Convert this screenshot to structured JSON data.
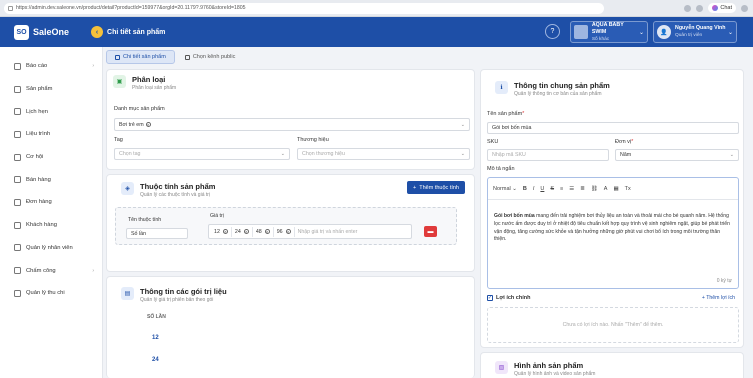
{
  "browser": {
    "url": "https://admin.dev.saleone.vn/product/detail?productId=159977&orgId=20.1179?.9760&storeId=1805",
    "chat_label": "Chat"
  },
  "topnav": {
    "logo": "SO",
    "brand": "SaleOne",
    "title": "Chi tiết sản phẩm",
    "help": "?",
    "store": {
      "name": "AQUA BABY SWIM",
      "sub": "Số khác"
    },
    "user": {
      "name": "Nguyễn Quang Vinh",
      "role": "Quản trị viên"
    }
  },
  "sidebar": {
    "items": [
      {
        "label": "Báo cáo",
        "chevron": "›"
      },
      {
        "label": "Sản phẩm"
      },
      {
        "label": "Lịch hẹn"
      },
      {
        "label": "Liệu trình"
      },
      {
        "label": "Cơ hội"
      },
      {
        "label": "Bán hàng"
      },
      {
        "label": "Đơn hàng"
      },
      {
        "label": "Khách hàng"
      },
      {
        "label": "Quản lý nhân viên"
      },
      {
        "label": "Chấm công",
        "chevron": "›"
      },
      {
        "label": "Quản lý thu chi"
      }
    ]
  },
  "tabs": [
    {
      "label": "Chi tiết sản phẩm"
    },
    {
      "label": "Chọn kênh public"
    }
  ],
  "classification": {
    "title": "Phân loại",
    "subtitle": "Phân loại sản phẩm",
    "category_label": "Danh mục sản phẩm",
    "category_value": "Bơi trẻ em",
    "tag_label": "Tag",
    "tag_placeholder": "Chọn tag",
    "brand_label": "Thương hiệu",
    "brand_placeholder": "Chọn thương hiệu"
  },
  "attributes": {
    "title": "Thuộc tính sản phẩm",
    "subtitle": "Quản lý các thuộc tính và giá trị",
    "add_button": "Thêm thuộc tính",
    "name_label": "Tên thuộc tính",
    "name_value": "Số lần",
    "value_label": "Giá trị",
    "values": [
      "12",
      "24",
      "48",
      "96"
    ],
    "value_placeholder": "Nhập giá trị và nhấn enter"
  },
  "packages": {
    "title": "Thông tin các gói trị liệu",
    "subtitle": "Quản lý giá trị phiên bản theo gói",
    "column": "SỐ LẦN",
    "rows": [
      "12",
      "24"
    ]
  },
  "general": {
    "title": "Thông tin chung sản phẩm",
    "subtitle": "Quản lý thông tin cơ bản của sản phẩm",
    "name_label": "Tên sản phẩm",
    "name_value": "Gói bơi bốn mùa",
    "sku_label": "SKU",
    "sku_placeholder": "Nhập mã SKU",
    "unit_label": "Đơn vị",
    "unit_value": "Năm",
    "desc_label": "Mô tả ngắn",
    "toolbar_format": "Normal",
    "desc_bold": "Gói bơi bốn mùa",
    "desc_text": " mang đến trải nghiệm bơi thủy liệu an toàn và thoải mái cho bé quanh năm. Hệ thống lọc nước ấm được duy trì ở nhiệt độ tiêu chuẩn kết hợp quy trình vệ sinh nghiêm ngặt, giúp bé phát triển vận động, tăng cường sức khỏe và tận hưởng những giờ phút vui chơi bổ ích trong môi trường thân thiện.",
    "char_count": "0 ký tự",
    "benefit_label": "Lợi ích chính",
    "add_benefit": "+ Thêm lợi ích",
    "benefit_empty": "Chưa có lợi ích nào. Nhấn \"Thêm\" để thêm."
  },
  "images": {
    "title": "Hình ảnh sản phẩm",
    "subtitle": "Quản lý hình ảnh và video sản phẩm"
  },
  "colors": {
    "primary": "#1e4fa7",
    "danger": "#e03b3b"
  }
}
